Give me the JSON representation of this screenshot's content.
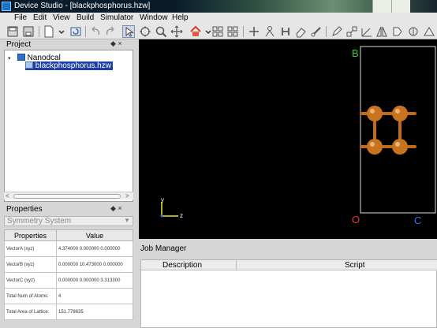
{
  "window": {
    "title": "Device Studio - [blackphosphorus.hzw]"
  },
  "menu": {
    "items": [
      "File",
      "Edit",
      "View",
      "Build",
      "Simulator",
      "Window",
      "Help"
    ]
  },
  "toolbar": {
    "icons": [
      "new-icon",
      "save-icon",
      "new-file-icon",
      "chevron-down-icon",
      "refresh-icon",
      "undo-icon",
      "redo-icon",
      "select-arrow-icon",
      "move-icon",
      "zoom-icon",
      "pan-icon",
      "home-icon",
      "grid-icon",
      "grid2-icon",
      "add-atom-icon",
      "person-icon",
      "hydrogen-icon",
      "eraser-icon",
      "bond-icon",
      "pencil-icon",
      "connect-icon",
      "measure-icon",
      "mirror-icon",
      "rotate-icon",
      "build-icon"
    ]
  },
  "project": {
    "title": "Project",
    "controls": "◆ ×",
    "tree": {
      "root": "Nanodcal",
      "child": "blackphosphorus.hzw"
    }
  },
  "properties": {
    "title": "Properties",
    "controls": "◆ ×",
    "symmetry_placeholder": "Symmetry System",
    "headers": [
      "Properties",
      "Value"
    ],
    "rows": [
      {
        "name": "VectorA (xyz)",
        "value": "4.374000 0.000000 0.000000"
      },
      {
        "name": "VectorB (xyz)",
        "value": "0.000000 10.473000 0.000000"
      },
      {
        "name": "VectorC (xyz)",
        "value": "0.000000 0.000000 3.313300"
      },
      {
        "name": "Total Num of Atoms:",
        "value": "4"
      },
      {
        "name": "Total Area of Lattice:",
        "value": "151.778635"
      }
    ]
  },
  "viewport": {
    "axes": {
      "x": "z",
      "y": "y"
    },
    "cell_labels": {
      "b": "B",
      "o": "O",
      "c": "C"
    },
    "colors": {
      "background": "#000000",
      "atom": "#c8741f",
      "bond": "#c06a1c",
      "cell": "#dddddd",
      "b_label": "#2bd12b",
      "o_label": "#e8342d",
      "c_label": "#3a6df0"
    }
  },
  "job_manager": {
    "title": "Job Manager",
    "columns": [
      "Description",
      "Script"
    ]
  }
}
